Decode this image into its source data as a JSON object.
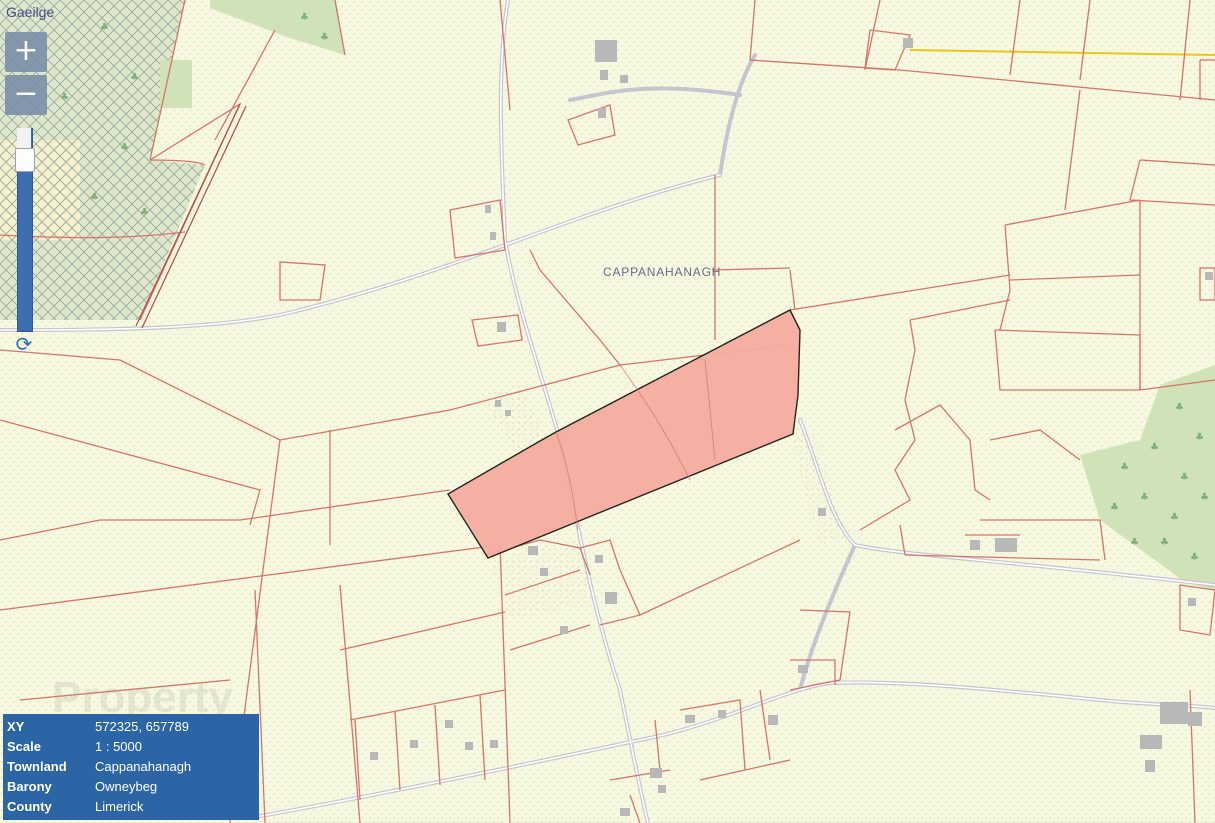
{
  "language_link": "Gaeilge",
  "controls": {
    "zoom_in": "+",
    "zoom_out": "−",
    "reset_icon": "refresh-icon",
    "zoom_level_fraction": 0.9
  },
  "map": {
    "townland_label": "CAPPANAHANAGH",
    "colors": {
      "background": "#f6f8df",
      "field_boundary": "#d9736a",
      "road": "#c9c9d4",
      "selected_parcel_fill": "#f5ada0",
      "selected_parcel_stroke": "#1a1a1a",
      "forest": "#cfe2b8",
      "building": "#b8b8b8",
      "power_line": "#f0c419"
    },
    "watermark": "PropertyPal.com"
  },
  "info": [
    {
      "key": "XY",
      "value": "572325, 657789"
    },
    {
      "key": "Scale",
      "value": "1 : 5000"
    },
    {
      "key": "Townland",
      "value": "Cappanahanagh"
    },
    {
      "key": "Barony",
      "value": "Owneybeg"
    },
    {
      "key": "County",
      "value": "Limerick"
    }
  ]
}
